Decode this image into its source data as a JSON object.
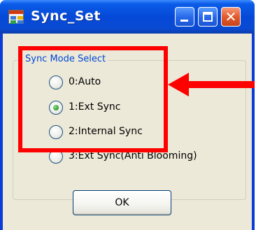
{
  "window": {
    "title": "Sync_Set",
    "controls": [
      "minimize",
      "maximize",
      "close"
    ],
    "close_glyph": "✕"
  },
  "group": {
    "label": "Sync Mode Select",
    "options": [
      {
        "label": "0:Auto",
        "selected": false
      },
      {
        "label": "1:Ext Sync",
        "selected": true
      },
      {
        "label": "2:Internal Sync",
        "selected": false
      },
      {
        "label": "3:Ext Sync(Anti Blooming)",
        "selected": false
      }
    ]
  },
  "buttons": {
    "ok_label": "OK"
  },
  "annotation": {
    "color": "#ff0000"
  },
  "colors": {
    "titlebar": "#0a5ce8",
    "client_bg": "#ece9d8",
    "group_label": "#0046d5",
    "radio_selected": "#3aa53a"
  }
}
